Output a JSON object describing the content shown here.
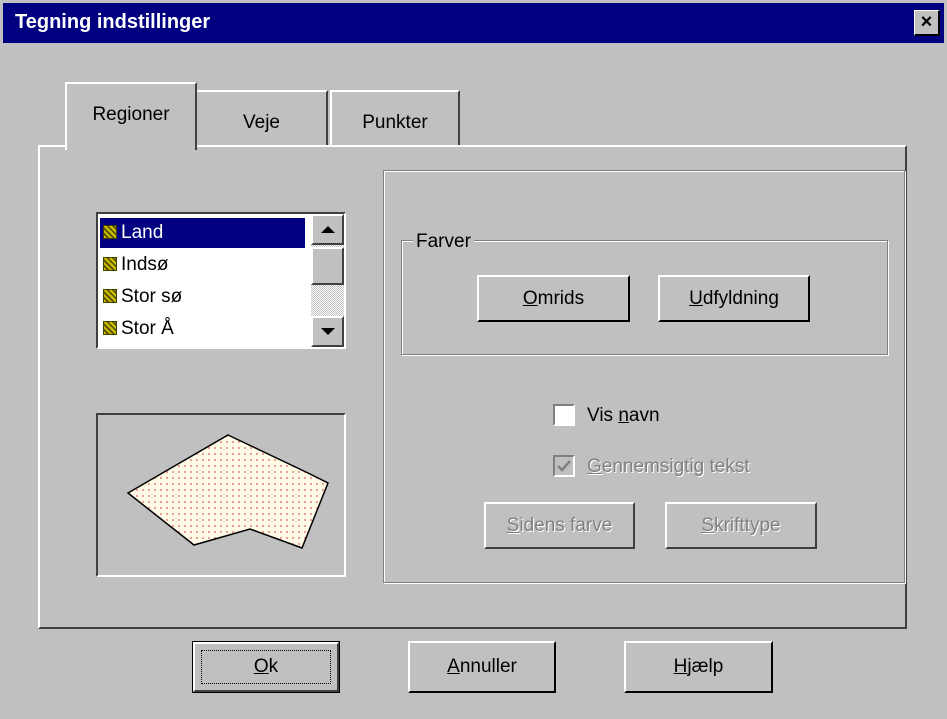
{
  "window": {
    "title": "Tegning indstillinger",
    "close_glyph": "×"
  },
  "tabs": [
    {
      "label": "Regioner",
      "active": true
    },
    {
      "label": "Veje",
      "active": false
    },
    {
      "label": "Punkter",
      "active": false
    }
  ],
  "list": {
    "items": [
      {
        "label": "Land",
        "selected": true,
        "icon": "region-icon"
      },
      {
        "label": "Indsø",
        "selected": false,
        "icon": "region-icon"
      },
      {
        "label": "Stor sø",
        "selected": false,
        "icon": "region-icon"
      },
      {
        "label": "Stor Å",
        "selected": false,
        "icon": "region-icon"
      }
    ]
  },
  "colors_group": {
    "label": "Farver",
    "outline_button": {
      "key": "O",
      "rest": "mrids"
    },
    "fill_button": {
      "key": "U",
      "rest": "dfyldning"
    }
  },
  "show_name": {
    "pre": "Vis ",
    "key": "n",
    "rest": "avn",
    "checked": false
  },
  "transparent_text": {
    "key": "G",
    "rest": "ennemsigtig tekst",
    "checked": true,
    "enabled": false
  },
  "page_color_button": {
    "key": "S",
    "rest": "idens farve",
    "enabled": false
  },
  "font_button": {
    "key": "S",
    "rest": "krifttype",
    "enabled": false
  },
  "footer": {
    "ok": {
      "key": "O",
      "rest": "k"
    },
    "cancel": {
      "key": "A",
      "rest": "nnuller"
    },
    "help": {
      "key": "H",
      "rest": "jælp"
    }
  },
  "colors": {
    "title_bar": "#000080",
    "face": "#c0c0c0",
    "selection": "#000080",
    "preview_fill": "#fffbe6",
    "preview_dots": "#e06060"
  }
}
